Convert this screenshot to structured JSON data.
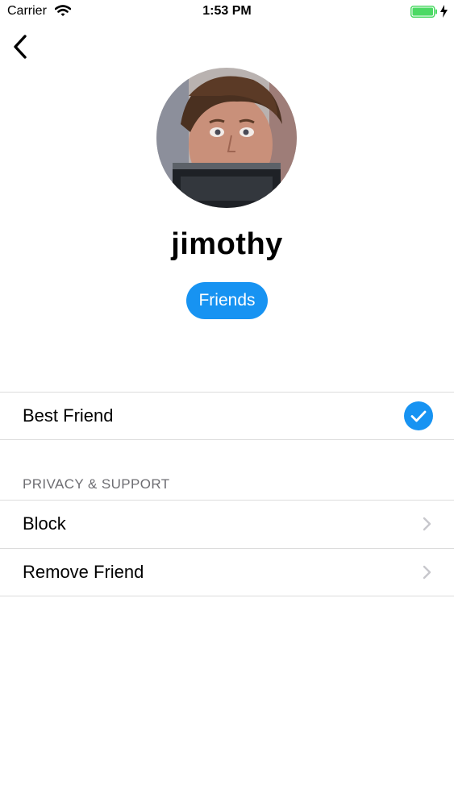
{
  "status_bar": {
    "carrier": "Carrier",
    "time": "1:53 PM",
    "battery_color": "#4cd964"
  },
  "profile": {
    "username": "jimothy",
    "friends_button_label": "Friends",
    "accent_color": "#1793f2"
  },
  "settings": {
    "best_friend": {
      "label": "Best Friend",
      "checked": true,
      "icon": "checkmark-circle-icon"
    },
    "section_header": "PRIVACY & SUPPORT",
    "items": [
      {
        "label": "Block",
        "icon": "chevron-right-icon"
      },
      {
        "label": "Remove Friend",
        "icon": "chevron-right-icon"
      }
    ]
  }
}
